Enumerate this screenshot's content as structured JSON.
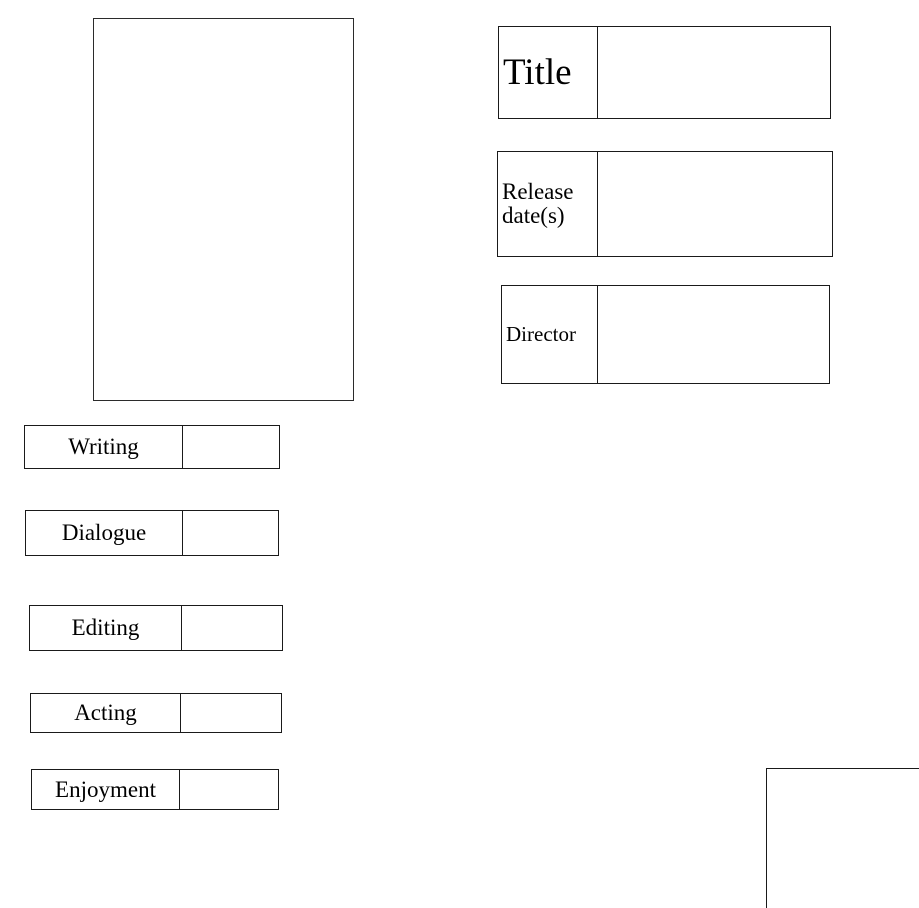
{
  "form": {
    "poster": {
      "placeholder_name": "poster-image-placeholder",
      "value": ""
    },
    "info_fields": [
      {
        "label": "Title",
        "value": ""
      },
      {
        "label": "Release\ndate(s)",
        "value": ""
      },
      {
        "label": "Director",
        "value": ""
      }
    ],
    "ratings": [
      {
        "label": "Writing",
        "value": ""
      },
      {
        "label": "Dialogue",
        "value": ""
      },
      {
        "label": "Editing",
        "value": ""
      },
      {
        "label": "Acting",
        "value": ""
      },
      {
        "label": "Enjoyment",
        "value": ""
      }
    ],
    "extra_region": {
      "name": "clipped-panel",
      "value": ""
    }
  },
  "colors": {
    "page_background": "#ffffff",
    "border": "#1a1a1a",
    "poster_border": "#2b2b2b",
    "text": "#000000"
  }
}
